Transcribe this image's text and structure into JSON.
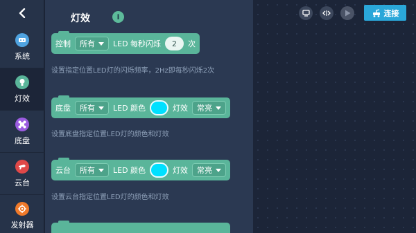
{
  "categories": [
    {
      "label": "系统",
      "icon": "robot-icon",
      "color": "#4fa3e0"
    },
    {
      "label": "灯效",
      "icon": "bulb-icon",
      "color": "#5ab59a",
      "active": true
    },
    {
      "label": "底盘",
      "icon": "chassis-icon",
      "color": "#9b5ce0"
    },
    {
      "label": "云台",
      "icon": "gimbal-icon",
      "color": "#e04848"
    },
    {
      "label": "发射器",
      "icon": "crosshair-icon",
      "color": "#f07a2a"
    }
  ],
  "flyout": {
    "title": "灯效",
    "info_symbol": "i",
    "blocks": [
      {
        "label": "控制",
        "dropdown": "所有",
        "text1": "LED 每秒闪烁",
        "value": "2",
        "text2": "次",
        "desc": "设置指定位置LED灯的闪烁频率，2Hz即每秒闪烁2次"
      },
      {
        "label": "底盘",
        "dropdown": "所有",
        "text1": "LED 颜色",
        "text2": "灯效",
        "effect": "常亮",
        "desc": "设置底盘指定位置LED灯的颜色和灯效"
      },
      {
        "label": "云台",
        "dropdown": "所有",
        "text1": "LED 颜色",
        "text2": "灯效",
        "effect": "常亮",
        "desc": "设置云台指定位置LED灯的颜色和灯效"
      }
    ],
    "swatch_color": "#00e0ff"
  },
  "toolbar": {
    "connect_label": "连接"
  }
}
